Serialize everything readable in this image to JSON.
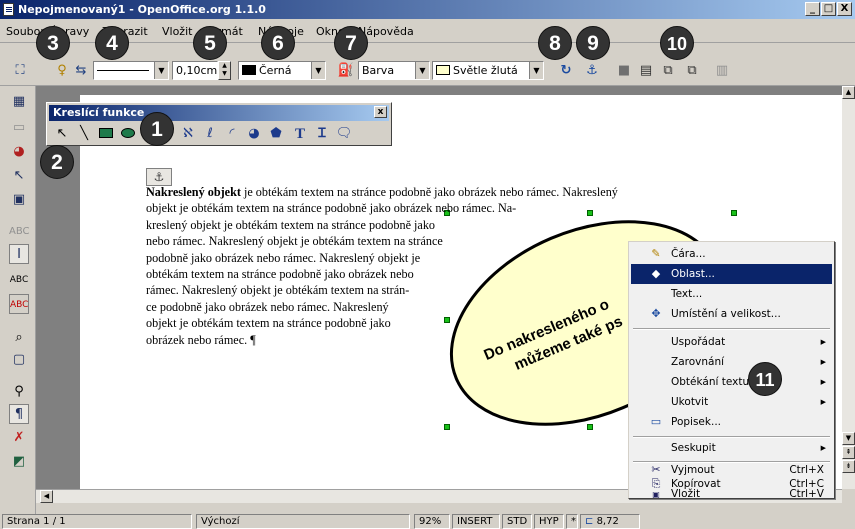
{
  "window": {
    "title": "Nepojmenovaný1 - OpenOffice.org 1.1.0",
    "controls": [
      "_",
      "□",
      "X"
    ]
  },
  "menubar": {
    "items": [
      "Soubor",
      "Úpravy",
      "Zobrazit",
      "Vložit",
      "Formát",
      "Nástroje",
      "Okno",
      "Nápověda"
    ]
  },
  "toolbar": {
    "line_width": "0,10cm",
    "line_color": "Černá",
    "area_style": "Barva",
    "area_color": "Světle žlutá",
    "colors": {
      "line_color": "#000000",
      "area_color": "#ffffcc"
    }
  },
  "draw_panel": {
    "title": "Kreslící funkce",
    "tools": [
      "select-arrow",
      "line",
      "rectangle",
      "ellipse",
      "polygon",
      "curve",
      "freeform",
      "arc",
      "sector",
      "segment",
      "text",
      "vertical-text",
      "callout"
    ]
  },
  "document": {
    "bold_lead": "Nakreslený objekt",
    "line1_rest": " je obtékám textem na stránce podobně jako obrázek nebo rámec. Nakreslený",
    "line2": "objekt je obtékám textem na stránce podobně jako obrázek nebo rámec. Na-",
    "lines": [
      "kreslený objekt je obtékám textem na stránce podobně jako",
      "nebo rámec. Nakreslený objekt je obtékám textem na stránce",
      "podobně jako obrázek nebo rámec. Nakreslený objekt je",
      "obtékám textem na stránce podobně jako obrázek nebo",
      "rámec. Nakreslený objekt je obtékám textem na strán-",
      "ce podobně jako obrázek nebo rámec. Nakreslený",
      "objekt je obtékám textem na stránce podobně jako",
      "obrázek nebo rámec. ¶"
    ],
    "line2_tail_hidden": "obrázek",
    "shape_text_1": "Do nakresleného o",
    "shape_text_2": "můžeme také ps",
    "shape_fill": "#ffffcc"
  },
  "context_menu": {
    "items": [
      {
        "icon": "pen-icon",
        "glyph": "✎",
        "label": "Čára..."
      },
      {
        "icon": "fill-bucket-icon",
        "glyph": "◆",
        "label": "Oblast...",
        "highlighted": true
      },
      {
        "icon": "",
        "glyph": "",
        "label": "Text..."
      },
      {
        "icon": "position-size-icon",
        "glyph": "✥",
        "label": "Umístění a velikost..."
      },
      {
        "icon": "",
        "glyph": "",
        "label": "Uspořádat",
        "submenu": true
      },
      {
        "icon": "",
        "glyph": "",
        "label": "Zarovnání",
        "submenu": true
      },
      {
        "icon": "",
        "glyph": "",
        "label": "Obtékání textu",
        "submenu": true
      },
      {
        "icon": "",
        "glyph": "",
        "label": "Ukotvit",
        "submenu": true
      },
      {
        "icon": "caption-icon",
        "glyph": "▭",
        "label": "Popisek..."
      },
      {
        "icon": "",
        "glyph": "",
        "label": "Seskupit",
        "submenu": true
      },
      {
        "icon": "scissors-icon",
        "glyph": "✂",
        "label": "Vyjmout",
        "shortcut": "Ctrl+X"
      },
      {
        "icon": "copy-icon",
        "glyph": "⎘",
        "label": "Kopírovat",
        "shortcut": "Ctrl+C"
      },
      {
        "icon": "paste-icon",
        "glyph": "📋",
        "label": "Vložit",
        "shortcut": "Ctrl+V"
      }
    ]
  },
  "statusbar": {
    "page": "Strana 1 / 1",
    "style": "Výchozí",
    "zoom": "92%",
    "mode": "INSERT",
    "std": "STD",
    "hyp": "HYP",
    "star": "*",
    "position": "8,72"
  },
  "badges": [
    "1",
    "2",
    "3",
    "4",
    "5",
    "6",
    "7",
    "8",
    "9",
    "10",
    "11"
  ]
}
